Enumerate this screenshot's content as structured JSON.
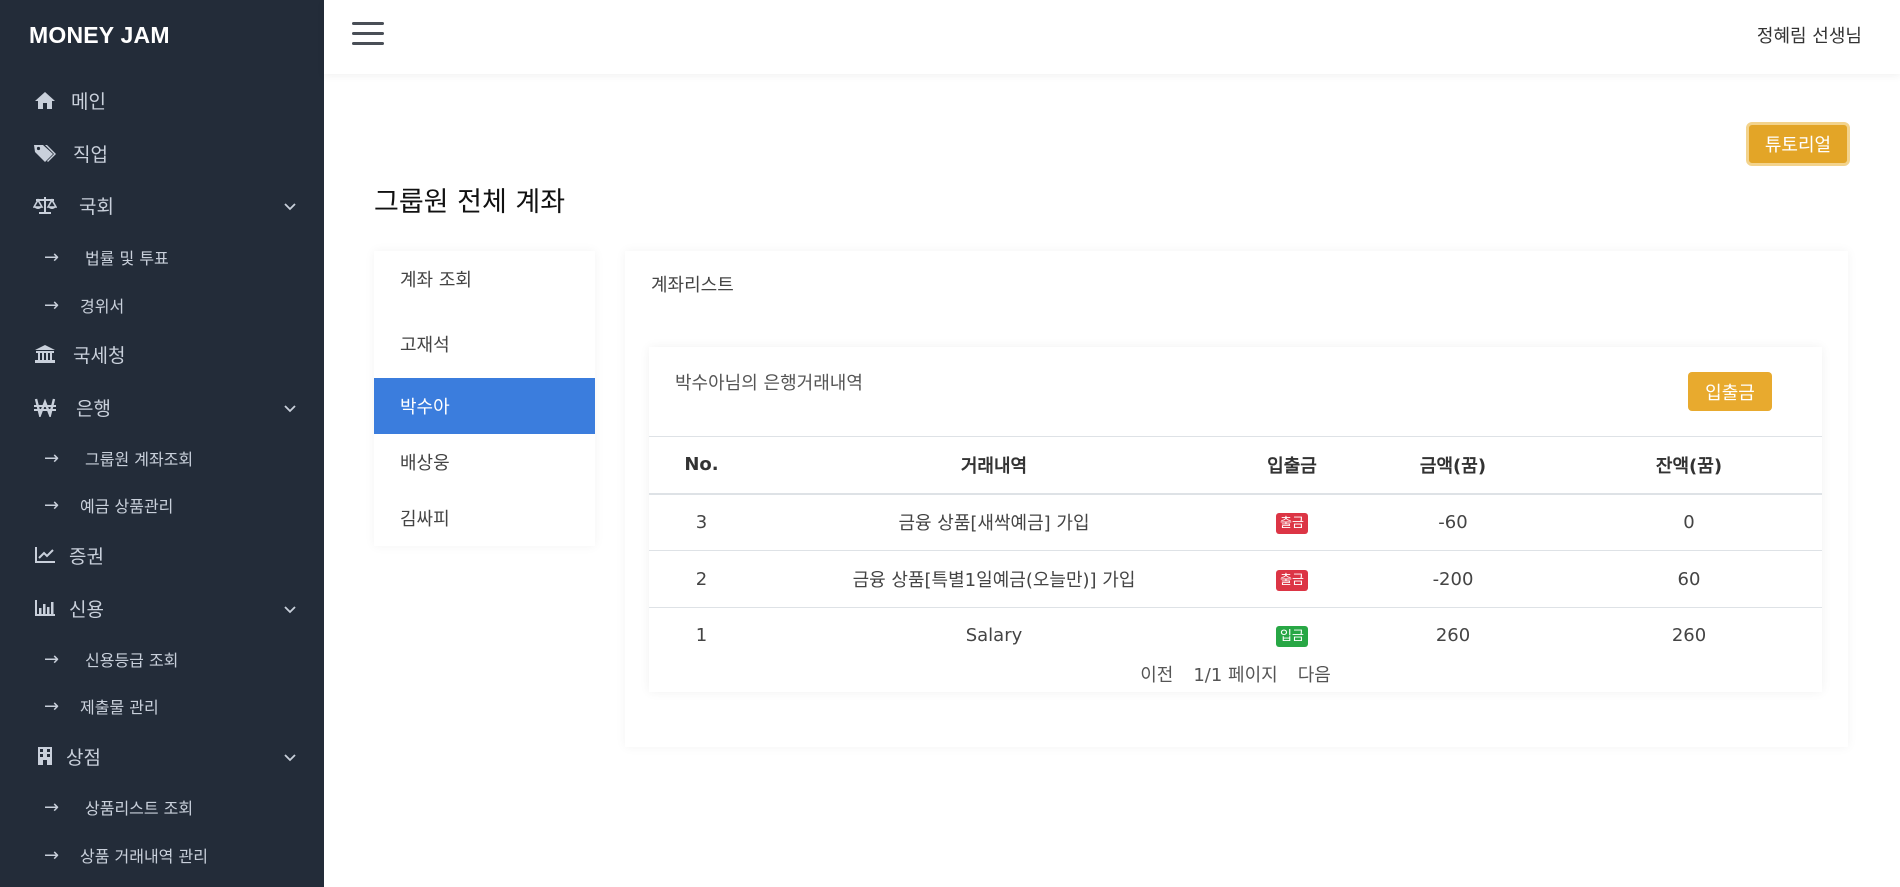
{
  "app": {
    "brand": "MONEY JAM"
  },
  "sidebar": {
    "items": [
      {
        "label": "메인",
        "icon": "home-icon"
      },
      {
        "label": "직업",
        "icon": "tags-icon"
      },
      {
        "label": "국회",
        "icon": "balance-scale-icon",
        "expandable": true
      },
      {
        "label": "법률 및 투표",
        "sub": true
      },
      {
        "label": "경위서",
        "sub": true
      },
      {
        "label": "국세청",
        "icon": "bank-icon"
      },
      {
        "label": "은행",
        "icon": "won-sign-icon",
        "expandable": true
      },
      {
        "label": "그룹원 계좌조회",
        "sub": true
      },
      {
        "label": "예금 상품관리",
        "sub": true
      },
      {
        "label": "증권",
        "icon": "line-chart-icon"
      },
      {
        "label": "신용",
        "icon": "bar-chart-icon",
        "expandable": true
      },
      {
        "label": "신용등급 조회",
        "sub": true
      },
      {
        "label": "제출물 관리",
        "sub": true
      },
      {
        "label": "상점",
        "icon": "building-icon",
        "expandable": true
      },
      {
        "label": "상품리스트 조회",
        "sub": true
      },
      {
        "label": "상품 거래내역 관리",
        "sub": true
      }
    ]
  },
  "header": {
    "user": "정혜림 선생님"
  },
  "main": {
    "tutorial_label": "튜토리얼",
    "title": "그룹원 전체 계좌",
    "members": {
      "items": [
        "계좌 조회",
        "고재석",
        "박수아",
        "배상웅",
        "김싸피"
      ],
      "active": "박수아"
    },
    "list": {
      "title": "계좌리스트",
      "tx_title": "박수아님의 은행거래내역",
      "deposit_label": "입출금",
      "columns": [
        "No.",
        "거래내역",
        "입출금",
        "금액(꿈)",
        "잔액(꿈)"
      ],
      "rows": [
        {
          "no": "3",
          "desc": "금융 상품[새싹예금] 가입",
          "type": "출금",
          "amount": "-60",
          "balance": "0"
        },
        {
          "no": "2",
          "desc": "금융 상품[특별1일예금(오늘만)] 가입",
          "type": "출금",
          "amount": "-200",
          "balance": "60"
        },
        {
          "no": "1",
          "desc": "Salary",
          "type": "입금",
          "amount": "260",
          "balance": "260"
        }
      ],
      "pager": {
        "prev": "이전",
        "page": "1/1 페이지",
        "next": "다음"
      }
    }
  },
  "colors": {
    "sidebar_bg": "#232c39",
    "active_blue": "#3b7ddd",
    "tutorial_yellow": "#e3a527",
    "withdraw_red": "#dc3545",
    "deposit_green": "#28a745"
  }
}
